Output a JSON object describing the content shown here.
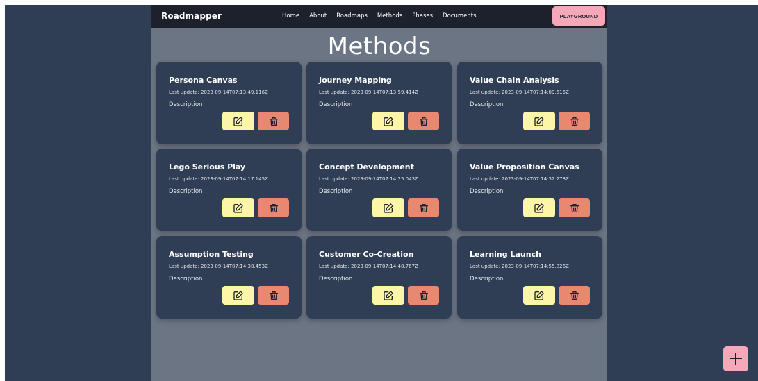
{
  "navbar": {
    "brand": "Roadmapper",
    "links": [
      "Home",
      "About",
      "Roadmaps",
      "Methods",
      "Phases",
      "Documents"
    ],
    "playground_label": "PLAYGROUND"
  },
  "page": {
    "title": "Methods"
  },
  "cards": [
    {
      "title": "Persona Canvas",
      "date": "Last update: 2023-09-14T07:13:49.116Z",
      "description": "Description"
    },
    {
      "title": "Journey Mapping",
      "date": "Last update: 2023-09-14T07:13:59.414Z",
      "description": "Description"
    },
    {
      "title": "Value Chain Analysis",
      "date": "Last update: 2023-09-14T07:14:09.515Z",
      "description": "Description"
    },
    {
      "title": "Lego Serious Play",
      "date": "Last update: 2023-09-14T07:14:17.145Z",
      "description": "Description"
    },
    {
      "title": "Concept Development",
      "date": "Last update: 2023-09-14T07:14:25.043Z",
      "description": "Description"
    },
    {
      "title": "Value Proposition Canvas",
      "date": "Last update: 2023-09-14T07:14:32.278Z",
      "description": "Description"
    },
    {
      "title": "Assumption Testing",
      "date": "Last update: 2023-09-14T07:14:38.453Z",
      "description": "Description"
    },
    {
      "title": "Customer Co-Creation",
      "date": "Last update: 2023-09-14T07:14:48.767Z",
      "description": "Description"
    },
    {
      "title": "Learning Launch",
      "date": "Last update: 2023-09-14T07:14:55.826Z",
      "description": "Description"
    }
  ],
  "icons": {
    "edit": "edit-icon",
    "delete": "trash-icon",
    "add": "plus-icon"
  },
  "colors": {
    "background": "#2f3e55",
    "content": "#6c7584",
    "navbar": "#1c212c",
    "accent_pink": "#f5a9b8",
    "edit_yellow": "#fdf6a8",
    "delete_red": "#e98870"
  }
}
